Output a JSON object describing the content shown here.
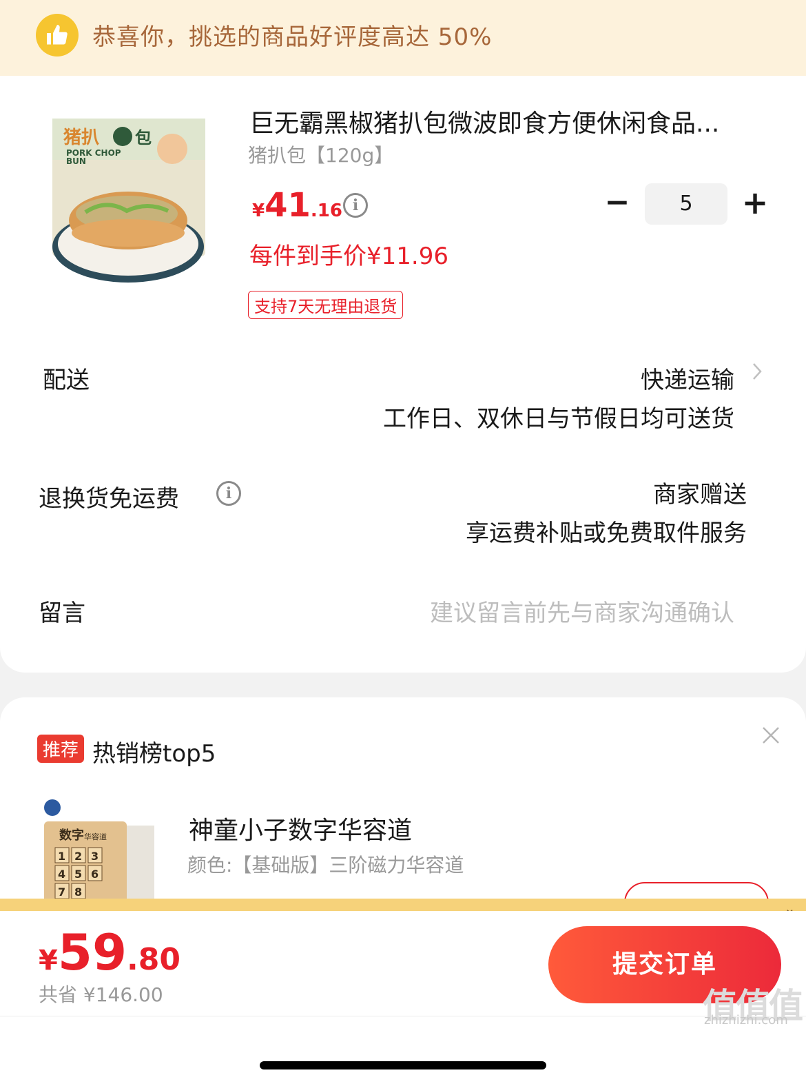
{
  "banner": {
    "text": "恭喜你，挑选的商品好评度高达 50%",
    "icon": "thumbs-up-icon"
  },
  "product": {
    "title": "巨无霸黑椒猪扒包微波即食方便休闲食品...",
    "spec": "猪扒包【120g】",
    "image_text": "猪扒包 PORK CHOP BUN",
    "price_currency": "¥",
    "price_int": "41",
    "price_dec": ".16",
    "unit_price": "每件到手价¥11.96",
    "return_tag": "支持7天无理由退货",
    "quantity": "5",
    "minus_label": "−",
    "plus_label": "+"
  },
  "delivery": {
    "label": "配送",
    "method": "快递运输",
    "detail": "工作日、双休日与节假日均可送货"
  },
  "return_shipping": {
    "label": "退换货免运费",
    "value": "商家赠送",
    "detail": "享运费补贴或免费取件服务"
  },
  "message": {
    "label": "留言",
    "placeholder": "建议留言前先与商家沟通确认"
  },
  "recommend": {
    "tag": "推荐",
    "title": "热销榜top5",
    "item_name": "神童小子数字华容道",
    "item_spec": "颜色:【基础版】三阶磁力华容道",
    "item_image_text": "数字华容道"
  },
  "footer": {
    "currency": "¥",
    "total_int": "59",
    "total_dec": ".80",
    "saved": "共省 ¥146.00",
    "submit_label": "提交订单",
    "watermark": "zhizhizhi.com",
    "watermark_logo": "值值值"
  },
  "colors": {
    "accent_red": "#e8202a",
    "banner_bg": "#fdf2dc",
    "banner_text": "#a7673a"
  }
}
